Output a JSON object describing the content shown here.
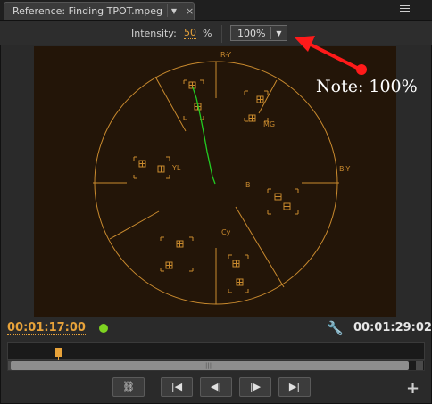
{
  "tab": {
    "title": "Reference: Finding TPOT.mpeg"
  },
  "panel_menu": {
    "icon": "panel-menu-icon"
  },
  "controls": {
    "intensity_label": "Intensity:",
    "intensity_value": "50",
    "percent_sign": "%",
    "zoom_value": "100%"
  },
  "scope": {
    "labels": {
      "ry": "R-Y",
      "mg": "MG",
      "by": "B-Y",
      "b": "B",
      "cy": "Cy",
      "yl": "YL"
    }
  },
  "annotation": {
    "text": "Note: 100%"
  },
  "timecode": {
    "current": "00:01:17:00",
    "duration": "00:01:29:02"
  },
  "colors": {
    "accent": "#e8a33a",
    "scope_bg": "#231508",
    "trace": "#22cc22",
    "note_arrow": "#ff1a1a"
  }
}
